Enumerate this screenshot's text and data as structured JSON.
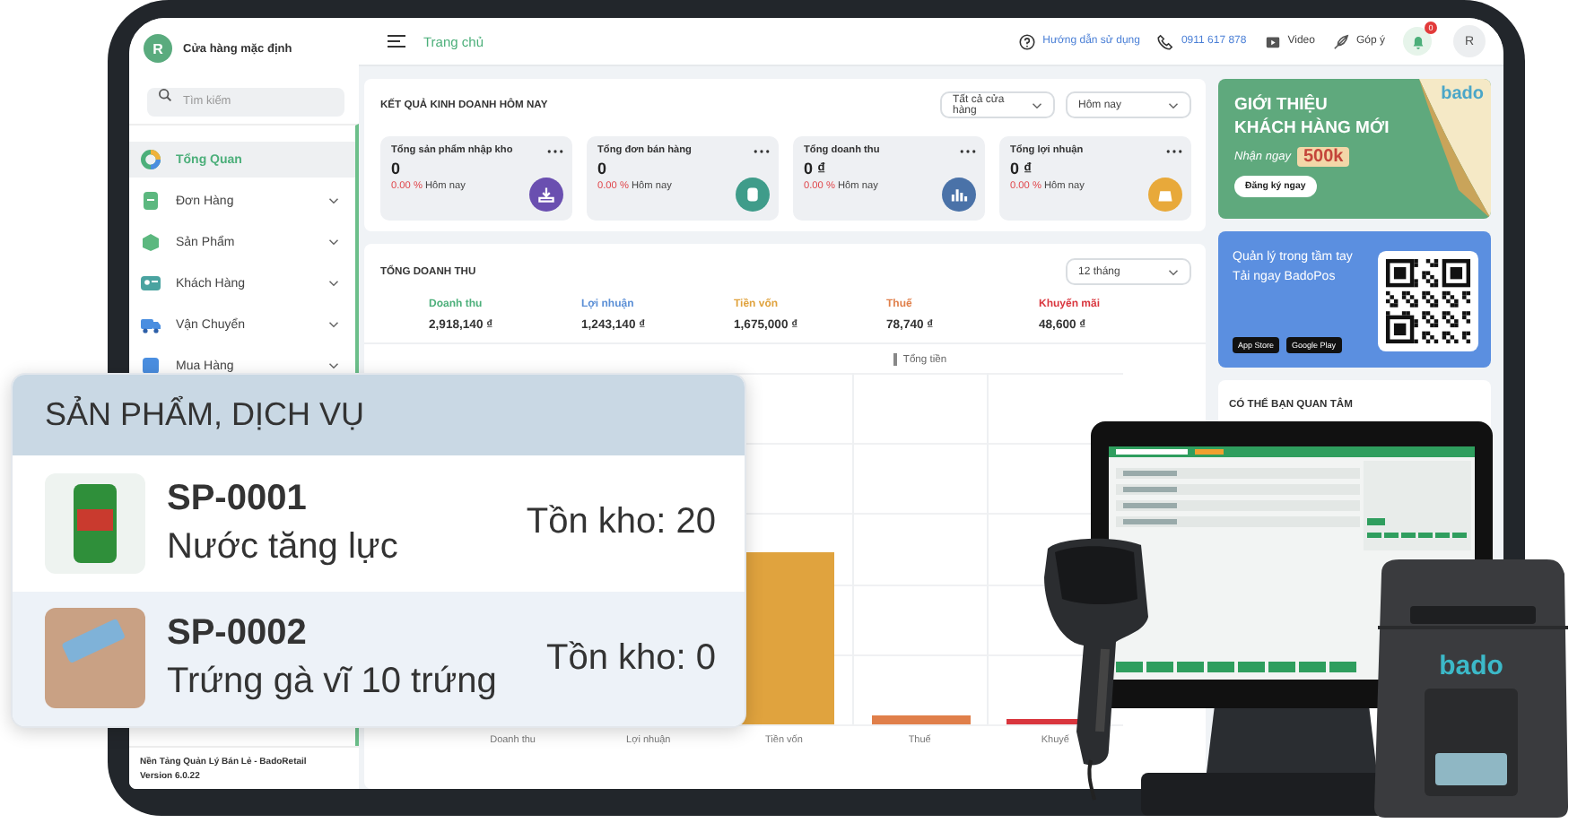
{
  "sidebar": {
    "store_avatar": "R",
    "store_name": "Cửa hàng mặc định",
    "search": {
      "placeholder": "Tìm kiếm"
    },
    "items": [
      {
        "label": "Tổng Quan",
        "selected": true,
        "expandable": false
      },
      {
        "label": "Đơn Hàng",
        "selected": false,
        "expandable": true
      },
      {
        "label": "Sản Phẩm",
        "selected": false,
        "expandable": true
      },
      {
        "label": "Khách Hàng",
        "selected": false,
        "expandable": true
      },
      {
        "label": "Vận Chuyển",
        "selected": false,
        "expandable": true
      },
      {
        "label": "Mua Hàng",
        "selected": false,
        "expandable": true
      }
    ],
    "footer": [
      "Nền Tảng Quản Lý Bán Lẻ - BadoRetail",
      "Version 6.0.22"
    ]
  },
  "header": {
    "title": "Trang chủ",
    "help": "Hướng dẫn sử dụng",
    "phone": "0911 617 878",
    "video": "Video",
    "feedback": "Góp ý",
    "notification_count": "0",
    "user_avatar": "R"
  },
  "today": {
    "title": "KẾT QUẢ KINH DOANH HÔM NAY",
    "filters": [
      "Tất cả cửa hàng",
      "Hôm nay"
    ],
    "stats": [
      {
        "title": "Tổng sản phẩm nhập kho",
        "value": "0",
        "change": "0.00 %",
        "period": "Hôm nay",
        "color": "#6a4fb0"
      },
      {
        "title": "Tổng đơn bán hàng",
        "value": "0",
        "change": "0.00 %",
        "period": "Hôm nay",
        "color": "#3f9c8a"
      },
      {
        "title": "Tổng doanh thu",
        "value": "0 ₫",
        "change": "0.00 %",
        "period": "Hôm nay",
        "color": "#4a72a8"
      },
      {
        "title": "Tổng lợi nhuận",
        "value": "0 ₫",
        "change": "0.00 %",
        "period": "Hôm nay",
        "color": "#e8a93a"
      }
    ]
  },
  "revenue": {
    "title": "TỔNG DOANH THU",
    "filter": "12 tháng",
    "metrics": [
      {
        "label": "Doanh thu",
        "value": "2,918,140 ₫",
        "color": "#4caf7a"
      },
      {
        "label": "Lợi nhuận",
        "value": "1,243,140 ₫",
        "color": "#5b8fd6"
      },
      {
        "label": "Tiền vốn",
        "value": "1,675,000 ₫",
        "color": "#e0a33e"
      },
      {
        "label": "Thuế",
        "value": "78,740 ₫",
        "color": "#e07f4a"
      },
      {
        "label": "Khuyến mãi",
        "value": "48,600 ₫",
        "color": "#d9363e"
      }
    ],
    "chart": {
      "legend": "Tổng tiền",
      "categories": [
        "Doanh thu",
        "Lợi nhuận",
        "Tiền vốn",
        "Thuế",
        "Khuyế"
      ]
    }
  },
  "promo": {
    "heading_lines": [
      "GIỚI THIỆU",
      "KHÁCH HÀNG MỚI"
    ],
    "offer_label": "Nhận ngay",
    "offer_amount": "500k",
    "button": "Đăng ký ngay",
    "logo": "bado"
  },
  "app_card": {
    "lines": [
      "Quản lý trong tầm tay",
      "Tải ngay BadoPos"
    ],
    "badges": [
      "App Store",
      "Google Play"
    ]
  },
  "suggestions": {
    "title": "CÓ THỂ BẠN QUAN TÂM"
  },
  "product_popup": {
    "title": "SẢN PHẨM, DỊCH VỤ",
    "products": [
      {
        "code": "SP-0001",
        "name": "Nước tăng lực",
        "stock": "Tồn kho: 20"
      },
      {
        "code": "SP-0002",
        "name": "Trứng gà vĩ 10 trứng",
        "stock": "Tồn kho: 0"
      }
    ]
  },
  "printer": {
    "logo": "bado"
  }
}
